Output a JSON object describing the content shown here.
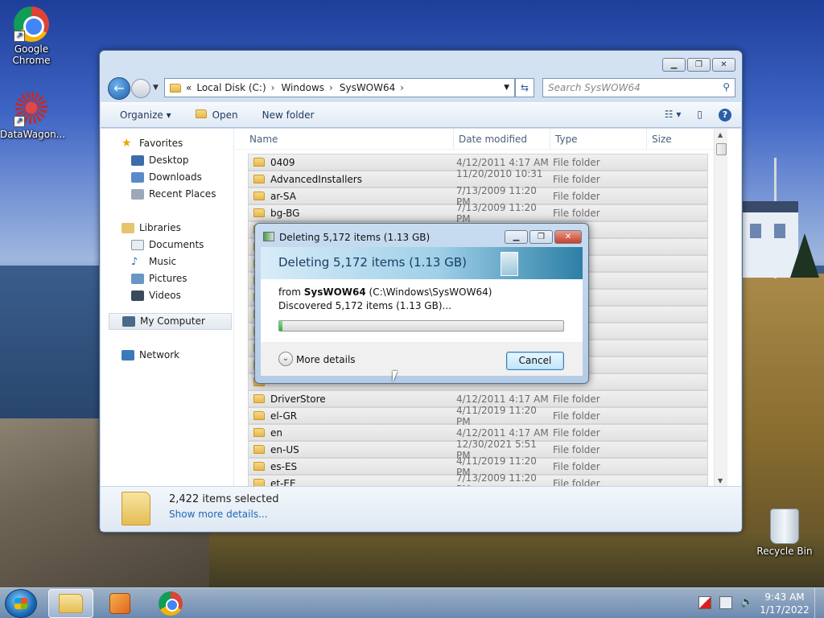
{
  "desktop": {
    "icons": [
      {
        "label": "Google Chrome",
        "icon": "chrome-icon"
      },
      {
        "label": "DataWagon...",
        "icon": "datawagon-icon"
      },
      {
        "label": "Recycle Bin",
        "icon": "recycle-bin-icon"
      }
    ]
  },
  "explorer": {
    "address": {
      "overflow": "«",
      "crumbs": [
        "Local Disk (C:)",
        "Windows",
        "SysWOW64"
      ],
      "search_placeholder": "Search SysWOW64"
    },
    "toolbar": {
      "organize": "Organize ▾",
      "open": "Open",
      "new_folder": "New folder"
    },
    "nav": {
      "favorites": "Favorites",
      "desktop": "Desktop",
      "downloads": "Downloads",
      "recent": "Recent Places",
      "libraries": "Libraries",
      "documents": "Documents",
      "music": "Music",
      "pictures": "Pictures",
      "videos": "Videos",
      "computer": "My Computer",
      "network": "Network"
    },
    "columns": {
      "name": "Name",
      "date": "Date modified",
      "type": "Type",
      "size": "Size"
    },
    "rows": [
      {
        "name": "0409",
        "date": "4/12/2011 4:17 AM",
        "type": "File folder"
      },
      {
        "name": "AdvancedInstallers",
        "date": "11/20/2010 10:31 ...",
        "type": "File folder"
      },
      {
        "name": "ar-SA",
        "date": "7/13/2009 11:20 PM",
        "type": "File folder"
      },
      {
        "name": "bg-BG",
        "date": "7/13/2009 11:20 PM",
        "type": "File folder"
      },
      {
        "name": "",
        "date": "",
        "type": "folder"
      },
      {
        "name": "",
        "date": "",
        "type": "folder"
      },
      {
        "name": "",
        "date": "",
        "type": "folder"
      },
      {
        "name": "",
        "date": "",
        "type": "folder"
      },
      {
        "name": "",
        "date": "",
        "type": "folder"
      },
      {
        "name": "",
        "date": "",
        "type": "folder"
      },
      {
        "name": "",
        "date": "",
        "type": "folder"
      },
      {
        "name": "",
        "date": "",
        "type": "folder"
      },
      {
        "name": "",
        "date": "",
        "type": "folder"
      },
      {
        "name": "",
        "date": "",
        "type": "folder"
      },
      {
        "name": "DriverStore",
        "date": "4/12/2011 4:17 AM",
        "type": "File folder"
      },
      {
        "name": "el-GR",
        "date": "4/11/2019 11:20 PM",
        "type": "File folder"
      },
      {
        "name": "en",
        "date": "4/12/2011 4:17 AM",
        "type": "File folder"
      },
      {
        "name": "en-US",
        "date": "12/30/2021 5:51 PM",
        "type": "File folder"
      },
      {
        "name": "es-ES",
        "date": "4/11/2019 11:20 PM",
        "type": "File folder"
      },
      {
        "name": "et-EE",
        "date": "7/13/2009 11:20 PM",
        "type": "File folder"
      }
    ],
    "details": {
      "selected": "2,422 items selected",
      "more": "Show more details..."
    }
  },
  "dialog": {
    "title": "Deleting 5,172 items (1.13 GB)",
    "heading": "Deleting 5,172 items (1.13 GB)",
    "from_prefix": "from ",
    "from_name": "SysWOW64",
    "from_path": " (C:\\Windows\\SysWOW64)",
    "discovered": "Discovered 5,172 items (1.13 GB)...",
    "progress_percent": 1,
    "more_details": "More details",
    "cancel": "Cancel"
  },
  "taskbar": {
    "time": "9:43 AM",
    "date": "1/17/2022"
  }
}
